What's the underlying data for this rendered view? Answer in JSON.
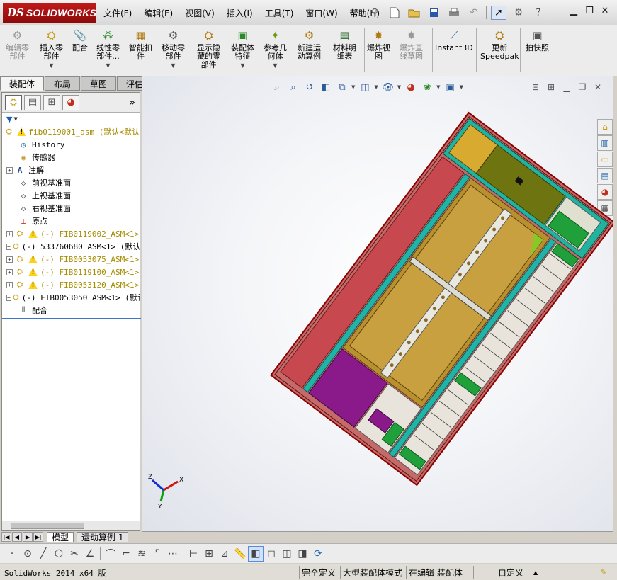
{
  "app": {
    "logo_prefix": "DS",
    "logo_name": "SOLIDWORKS"
  },
  "menu": [
    "文件(F)",
    "编辑(E)",
    "视图(V)",
    "插入(I)",
    "工具(T)",
    "窗口(W)",
    "帮助(H)"
  ],
  "quick_icons": [
    "pin-icon",
    "new-doc-icon",
    "open-icon",
    "save-icon",
    "print-icon",
    "undo-icon",
    "select-icon",
    "options-icon",
    "help-icon"
  ],
  "window_buttons": [
    "minimize",
    "restore",
    "close"
  ],
  "commands": [
    {
      "label_1": "编辑零",
      "label_2": "部件",
      "icon": "edit-component-icon",
      "disabled": true,
      "has_arrow": false
    },
    {
      "label_1": "插入零",
      "label_2": "部件",
      "icon": "insert-component-icon",
      "disabled": false,
      "has_arrow": true
    },
    {
      "label_1": "配合",
      "label_2": "",
      "icon": "mate-icon",
      "disabled": false,
      "has_arrow": false
    },
    {
      "label_1": "线性零",
      "label_2": "部件...",
      "icon": "linear-pattern-icon",
      "disabled": false,
      "has_arrow": true
    },
    {
      "label_1": "智能扣",
      "label_2": "件",
      "icon": "smart-fastener-icon",
      "disabled": false,
      "has_arrow": false
    },
    {
      "label_1": "移动零",
      "label_2": "部件",
      "icon": "move-component-icon",
      "disabled": false,
      "has_arrow": true
    },
    {
      "label_1": "显示隐",
      "label_2": "藏的零",
      "label_3": "部件",
      "icon": "show-hidden-icon",
      "disabled": false,
      "has_arrow": false
    },
    {
      "label_1": "装配体",
      "label_2": "特征",
      "icon": "assembly-feature-icon",
      "disabled": false,
      "has_arrow": true
    },
    {
      "label_1": "参考几",
      "label_2": "何体",
      "icon": "reference-geometry-icon",
      "disabled": false,
      "has_arrow": true
    },
    {
      "label_1": "新建运",
      "label_2": "动算例",
      "icon": "new-motion-study-icon",
      "disabled": false,
      "has_arrow": false
    },
    {
      "label_1": "材料明",
      "label_2": "细表",
      "icon": "bom-icon",
      "disabled": false,
      "has_arrow": false
    },
    {
      "label_1": "爆炸视",
      "label_2": "图",
      "icon": "exploded-view-icon",
      "disabled": false,
      "has_arrow": false
    },
    {
      "label_1": "爆炸直",
      "label_2": "线草图",
      "icon": "explode-line-sketch-icon",
      "disabled": true,
      "has_arrow": false
    },
    {
      "label_1": "Instant3D",
      "label_2": "",
      "icon": "instant3d-icon",
      "disabled": false,
      "has_arrow": false
    },
    {
      "label_1": "更新",
      "label_2": "Speedpak",
      "icon": "speedpak-icon",
      "disabled": false,
      "has_arrow": false
    },
    {
      "label_1": "拍快照",
      "label_2": "",
      "icon": "snapshot-icon",
      "disabled": false,
      "has_arrow": false
    }
  ],
  "cmd_tabs": [
    "装配体",
    "布局",
    "草图",
    "评估"
  ],
  "cmd_tab_active": "装配体",
  "panel": {
    "tabs": [
      "feature-manager-icon",
      "property-manager-icon",
      "configuration-manager-icon",
      "display-manager-icon"
    ],
    "tree": [
      {
        "text": "fib0119001_asm (默认<默认",
        "kind": "root",
        "warn": true
      },
      {
        "text": "History",
        "kind": "history"
      },
      {
        "text": "传感器",
        "kind": "sensor"
      },
      {
        "text": "注解",
        "kind": "annotation",
        "expand": true
      },
      {
        "text": "前视基准面",
        "kind": "plane"
      },
      {
        "text": "上视基准面",
        "kind": "plane"
      },
      {
        "text": "右视基准面",
        "kind": "plane"
      },
      {
        "text": "原点",
        "kind": "origin"
      },
      {
        "text": "(-) FIB0119002_ASM<1>",
        "kind": "subasm",
        "warn": true,
        "yellow": true,
        "expand": true
      },
      {
        "text": "(-) 533760680_ASM<1> (默认",
        "kind": "subasm",
        "warn": false,
        "yellow": false,
        "expand": true
      },
      {
        "text": "(-) FIB0053075_ASM<1>",
        "kind": "subasm",
        "warn": true,
        "yellow": true,
        "expand": true
      },
      {
        "text": "(-) FIB0119100_ASM<1>",
        "kind": "subasm",
        "warn": true,
        "yellow": true,
        "expand": true
      },
      {
        "text": "(-) FIB0053120_ASM<1>",
        "kind": "subasm",
        "warn": true,
        "yellow": true,
        "expand": true
      },
      {
        "text": "(-) FIB0053050_ASM<1> (默认",
        "kind": "subasm",
        "warn": false,
        "yellow": false,
        "expand": true
      },
      {
        "text": "配合",
        "kind": "mates"
      }
    ]
  },
  "bottom_tabs": [
    "模型",
    "运动算例 1"
  ],
  "bottom_tab_active": "模型",
  "triad": {
    "x": "X",
    "y": "Y",
    "z": "Z"
  },
  "status": {
    "version": "SolidWorks 2014 x64 版",
    "definition": "完全定义",
    "mode": "大型装配体模式",
    "editing": "在编辑 装配体",
    "custom": "自定义",
    "custom_arrow": "▲"
  },
  "colors": {
    "cabinet_outline": "#8b0000",
    "red_panel": "#c84850",
    "orange_panel": "#c8a040",
    "teal_rail": "#20b4a8",
    "purple_block": "#8a1a8a",
    "green_block": "#1fa03a",
    "olive_block": "#6e7410",
    "yellow_top": "#d8aa30"
  }
}
